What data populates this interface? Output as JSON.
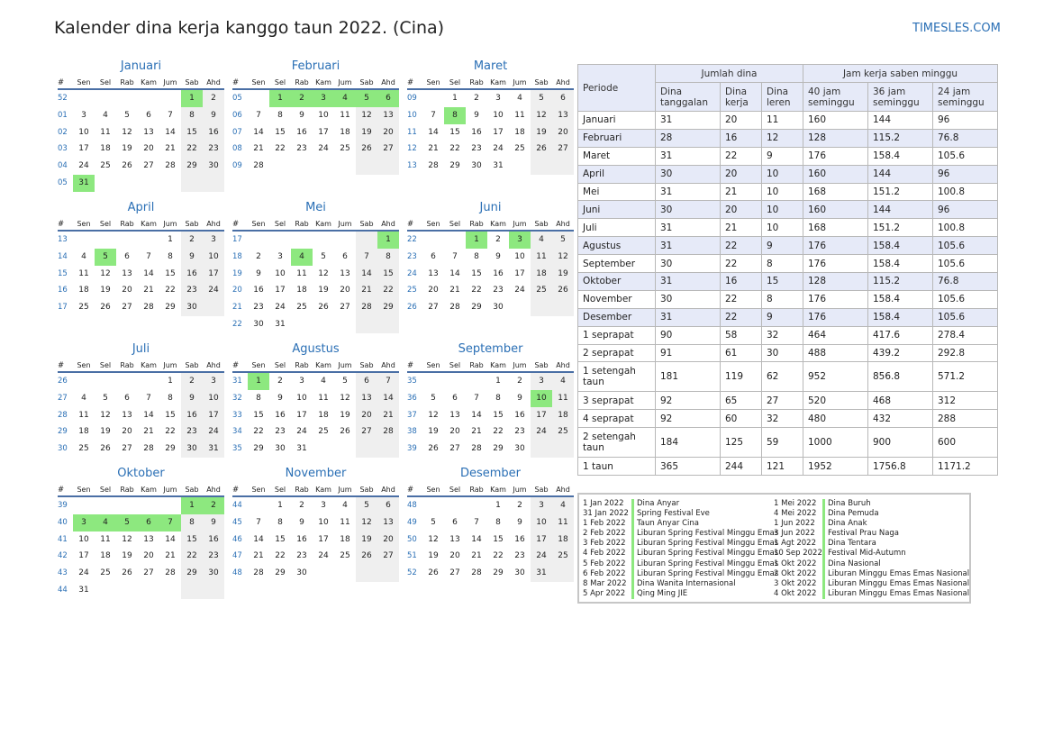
{
  "title": "Kalender dina kerja kanggo taun 2022. (Cina)",
  "brand": "TIMESLES.COM",
  "weekday_headers": [
    "#",
    "Sen",
    "Sel",
    "Rab",
    "Kam",
    "Jum",
    "Sab",
    "Ahd"
  ],
  "months": [
    {
      "name": "Januari",
      "rows": [
        {
          "wk": "52",
          "days": [
            "",
            "",
            "",
            "",
            "",
            "1",
            "2"
          ]
        },
        {
          "wk": "01",
          "days": [
            "3",
            "4",
            "5",
            "6",
            "7",
            "8",
            "9"
          ]
        },
        {
          "wk": "02",
          "days": [
            "10",
            "11",
            "12",
            "13",
            "14",
            "15",
            "16"
          ]
        },
        {
          "wk": "03",
          "days": [
            "17",
            "18",
            "19",
            "20",
            "21",
            "22",
            "23"
          ]
        },
        {
          "wk": "04",
          "days": [
            "24",
            "25",
            "26",
            "27",
            "28",
            "29",
            "30"
          ]
        },
        {
          "wk": "05",
          "days": [
            "31",
            "",
            "",
            "",
            "",
            "",
            ""
          ]
        }
      ],
      "holidays": [
        "1",
        "31"
      ]
    },
    {
      "name": "Februari",
      "rows": [
        {
          "wk": "05",
          "days": [
            "",
            "1",
            "2",
            "3",
            "4",
            "5",
            "6"
          ]
        },
        {
          "wk": "06",
          "days": [
            "7",
            "8",
            "9",
            "10",
            "11",
            "12",
            "13"
          ]
        },
        {
          "wk": "07",
          "days": [
            "14",
            "15",
            "16",
            "17",
            "18",
            "19",
            "20"
          ]
        },
        {
          "wk": "08",
          "days": [
            "21",
            "22",
            "23",
            "24",
            "25",
            "26",
            "27"
          ]
        },
        {
          "wk": "09",
          "days": [
            "28",
            "",
            "",
            "",
            "",
            "",
            ""
          ]
        }
      ],
      "holidays": [
        "1",
        "2",
        "3",
        "4",
        "5",
        "6"
      ]
    },
    {
      "name": "Maret",
      "rows": [
        {
          "wk": "09",
          "days": [
            "",
            "1",
            "2",
            "3",
            "4",
            "5",
            "6"
          ]
        },
        {
          "wk": "10",
          "days": [
            "7",
            "8",
            "9",
            "10",
            "11",
            "12",
            "13"
          ]
        },
        {
          "wk": "11",
          "days": [
            "14",
            "15",
            "16",
            "17",
            "18",
            "19",
            "20"
          ]
        },
        {
          "wk": "12",
          "days": [
            "21",
            "22",
            "23",
            "24",
            "25",
            "26",
            "27"
          ]
        },
        {
          "wk": "13",
          "days": [
            "28",
            "29",
            "30",
            "31",
            "",
            "",
            ""
          ]
        }
      ],
      "holidays": [
        "8"
      ]
    },
    {
      "name": "April",
      "rows": [
        {
          "wk": "13",
          "days": [
            "",
            "",
            "",
            "",
            "1",
            "2",
            "3"
          ]
        },
        {
          "wk": "14",
          "days": [
            "4",
            "5",
            "6",
            "7",
            "8",
            "9",
            "10"
          ]
        },
        {
          "wk": "15",
          "days": [
            "11",
            "12",
            "13",
            "14",
            "15",
            "16",
            "17"
          ]
        },
        {
          "wk": "16",
          "days": [
            "18",
            "19",
            "20",
            "21",
            "22",
            "23",
            "24"
          ]
        },
        {
          "wk": "17",
          "days": [
            "25",
            "26",
            "27",
            "28",
            "29",
            "30",
            ""
          ]
        }
      ],
      "holidays": [
        "5"
      ]
    },
    {
      "name": "Mei",
      "rows": [
        {
          "wk": "17",
          "days": [
            "",
            "",
            "",
            "",
            "",
            "",
            "1"
          ]
        },
        {
          "wk": "18",
          "days": [
            "2",
            "3",
            "4",
            "5",
            "6",
            "7",
            "8"
          ]
        },
        {
          "wk": "19",
          "days": [
            "9",
            "10",
            "11",
            "12",
            "13",
            "14",
            "15"
          ]
        },
        {
          "wk": "20",
          "days": [
            "16",
            "17",
            "18",
            "19",
            "20",
            "21",
            "22"
          ]
        },
        {
          "wk": "21",
          "days": [
            "23",
            "24",
            "25",
            "26",
            "27",
            "28",
            "29"
          ]
        },
        {
          "wk": "22",
          "days": [
            "30",
            "31",
            "",
            "",
            "",
            "",
            ""
          ]
        }
      ],
      "holidays": [
        "1",
        "4"
      ]
    },
    {
      "name": "Juni",
      "rows": [
        {
          "wk": "22",
          "days": [
            "",
            "",
            "1",
            "2",
            "3",
            "4",
            "5"
          ]
        },
        {
          "wk": "23",
          "days": [
            "6",
            "7",
            "8",
            "9",
            "10",
            "11",
            "12"
          ]
        },
        {
          "wk": "24",
          "days": [
            "13",
            "14",
            "15",
            "16",
            "17",
            "18",
            "19"
          ]
        },
        {
          "wk": "25",
          "days": [
            "20",
            "21",
            "22",
            "23",
            "24",
            "25",
            "26"
          ]
        },
        {
          "wk": "26",
          "days": [
            "27",
            "28",
            "29",
            "30",
            "",
            "",
            ""
          ]
        }
      ],
      "holidays": [
        "1",
        "3"
      ]
    },
    {
      "name": "Juli",
      "rows": [
        {
          "wk": "26",
          "days": [
            "",
            "",
            "",
            "",
            "1",
            "2",
            "3"
          ]
        },
        {
          "wk": "27",
          "days": [
            "4",
            "5",
            "6",
            "7",
            "8",
            "9",
            "10"
          ]
        },
        {
          "wk": "28",
          "days": [
            "11",
            "12",
            "13",
            "14",
            "15",
            "16",
            "17"
          ]
        },
        {
          "wk": "29",
          "days": [
            "18",
            "19",
            "20",
            "21",
            "22",
            "23",
            "24"
          ]
        },
        {
          "wk": "30",
          "days": [
            "25",
            "26",
            "27",
            "28",
            "29",
            "30",
            "31"
          ]
        }
      ],
      "holidays": []
    },
    {
      "name": "Agustus",
      "rows": [
        {
          "wk": "31",
          "days": [
            "1",
            "2",
            "3",
            "4",
            "5",
            "6",
            "7"
          ]
        },
        {
          "wk": "32",
          "days": [
            "8",
            "9",
            "10",
            "11",
            "12",
            "13",
            "14"
          ]
        },
        {
          "wk": "33",
          "days": [
            "15",
            "16",
            "17",
            "18",
            "19",
            "20",
            "21"
          ]
        },
        {
          "wk": "34",
          "days": [
            "22",
            "23",
            "24",
            "25",
            "26",
            "27",
            "28"
          ]
        },
        {
          "wk": "35",
          "days": [
            "29",
            "30",
            "31",
            "",
            "",
            "",
            ""
          ]
        }
      ],
      "holidays": [
        "1"
      ]
    },
    {
      "name": "September",
      "rows": [
        {
          "wk": "35",
          "days": [
            "",
            "",
            "",
            "1",
            "2",
            "3",
            "4"
          ]
        },
        {
          "wk": "36",
          "days": [
            "5",
            "6",
            "7",
            "8",
            "9",
            "10",
            "11"
          ]
        },
        {
          "wk": "37",
          "days": [
            "12",
            "13",
            "14",
            "15",
            "16",
            "17",
            "18"
          ]
        },
        {
          "wk": "38",
          "days": [
            "19",
            "20",
            "21",
            "22",
            "23",
            "24",
            "25"
          ]
        },
        {
          "wk": "39",
          "days": [
            "26",
            "27",
            "28",
            "29",
            "30",
            "",
            ""
          ]
        }
      ],
      "holidays": [
        "10"
      ]
    },
    {
      "name": "Oktober",
      "rows": [
        {
          "wk": "39",
          "days": [
            "",
            "",
            "",
            "",
            "",
            "1",
            "2"
          ]
        },
        {
          "wk": "40",
          "days": [
            "3",
            "4",
            "5",
            "6",
            "7",
            "8",
            "9"
          ]
        },
        {
          "wk": "41",
          "days": [
            "10",
            "11",
            "12",
            "13",
            "14",
            "15",
            "16"
          ]
        },
        {
          "wk": "42",
          "days": [
            "17",
            "18",
            "19",
            "20",
            "21",
            "22",
            "23"
          ]
        },
        {
          "wk": "43",
          "days": [
            "24",
            "25",
            "26",
            "27",
            "28",
            "29",
            "30"
          ]
        },
        {
          "wk": "44",
          "days": [
            "31",
            "",
            "",
            "",
            "",
            "",
            ""
          ]
        }
      ],
      "holidays": [
        "1",
        "2",
        "3",
        "4",
        "5",
        "6",
        "7"
      ]
    },
    {
      "name": "November",
      "rows": [
        {
          "wk": "44",
          "days": [
            "",
            "1",
            "2",
            "3",
            "4",
            "5",
            "6"
          ]
        },
        {
          "wk": "45",
          "days": [
            "7",
            "8",
            "9",
            "10",
            "11",
            "12",
            "13"
          ]
        },
        {
          "wk": "46",
          "days": [
            "14",
            "15",
            "16",
            "17",
            "18",
            "19",
            "20"
          ]
        },
        {
          "wk": "47",
          "days": [
            "21",
            "22",
            "23",
            "24",
            "25",
            "26",
            "27"
          ]
        },
        {
          "wk": "48",
          "days": [
            "28",
            "29",
            "30",
            "",
            "",
            "",
            ""
          ]
        }
      ],
      "holidays": []
    },
    {
      "name": "Desember",
      "rows": [
        {
          "wk": "48",
          "days": [
            "",
            "",
            "",
            "1",
            "2",
            "3",
            "4"
          ]
        },
        {
          "wk": "49",
          "days": [
            "5",
            "6",
            "7",
            "8",
            "9",
            "10",
            "11"
          ]
        },
        {
          "wk": "50",
          "days": [
            "12",
            "13",
            "14",
            "15",
            "16",
            "17",
            "18"
          ]
        },
        {
          "wk": "51",
          "days": [
            "19",
            "20",
            "21",
            "22",
            "23",
            "24",
            "25"
          ]
        },
        {
          "wk": "52",
          "days": [
            "26",
            "27",
            "28",
            "29",
            "30",
            "31",
            ""
          ]
        }
      ],
      "holidays": []
    }
  ],
  "table": {
    "periode": "Periode",
    "jumlah_dina": "Jumlah dina",
    "jam_kerja": "Jam kerja saben minggu",
    "subheaders": [
      "Dina tanggalan",
      "Dina kerja",
      "Dina leren",
      "40 jam seminggu",
      "36 jam seminggu",
      "24 jam seminggu"
    ],
    "rows": [
      [
        "Januari",
        "31",
        "20",
        "11",
        "160",
        "144",
        "96"
      ],
      [
        "Februari",
        "28",
        "16",
        "12",
        "128",
        "115.2",
        "76.8"
      ],
      [
        "Maret",
        "31",
        "22",
        "9",
        "176",
        "158.4",
        "105.6"
      ],
      [
        "April",
        "30",
        "20",
        "10",
        "160",
        "144",
        "96"
      ],
      [
        "Mei",
        "31",
        "21",
        "10",
        "168",
        "151.2",
        "100.8"
      ],
      [
        "Juni",
        "30",
        "20",
        "10",
        "160",
        "144",
        "96"
      ],
      [
        "Juli",
        "31",
        "21",
        "10",
        "168",
        "151.2",
        "100.8"
      ],
      [
        "Agustus",
        "31",
        "22",
        "9",
        "176",
        "158.4",
        "105.6"
      ],
      [
        "September",
        "30",
        "22",
        "8",
        "176",
        "158.4",
        "105.6"
      ],
      [
        "Oktober",
        "31",
        "16",
        "15",
        "128",
        "115.2",
        "76.8"
      ],
      [
        "November",
        "30",
        "22",
        "8",
        "176",
        "158.4",
        "105.6"
      ],
      [
        "Desember",
        "31",
        "22",
        "9",
        "176",
        "158.4",
        "105.6"
      ],
      [
        "1 seprapat",
        "90",
        "58",
        "32",
        "464",
        "417.6",
        "278.4"
      ],
      [
        "2 seprapat",
        "91",
        "61",
        "30",
        "488",
        "439.2",
        "292.8"
      ],
      [
        "1 setengah taun",
        "181",
        "119",
        "62",
        "952",
        "856.8",
        "571.2"
      ],
      [
        "3 seprapat",
        "92",
        "65",
        "27",
        "520",
        "468",
        "312"
      ],
      [
        "4 seprapat",
        "92",
        "60",
        "32",
        "480",
        "432",
        "288"
      ],
      [
        "2 setengah taun",
        "184",
        "125",
        "59",
        "1000",
        "900",
        "600"
      ],
      [
        "1 taun",
        "365",
        "244",
        "121",
        "1952",
        "1756.8",
        "1171.2"
      ]
    ]
  },
  "holidays_left": [
    {
      "date": "1 Jan 2022",
      "name": "Dina Anyar"
    },
    {
      "date": "31 Jan 2022",
      "name": "Spring Festival Eve"
    },
    {
      "date": "1 Feb 2022",
      "name": "Taun Anyar Cina"
    },
    {
      "date": "2 Feb 2022",
      "name": "Liburan Spring Festival Minggu Emas"
    },
    {
      "date": "3 Feb 2022",
      "name": "Liburan Spring Festival Minggu Emas"
    },
    {
      "date": "4 Feb 2022",
      "name": "Liburan Spring Festival Minggu Emas"
    },
    {
      "date": "5 Feb 2022",
      "name": "Liburan Spring Festival Minggu Emas"
    },
    {
      "date": "6 Feb 2022",
      "name": "Liburan Spring Festival Minggu Emas"
    },
    {
      "date": "8 Mar 2022",
      "name": "Dina Wanita Internasional"
    },
    {
      "date": "5 Apr 2022",
      "name": "Qing Ming JIE"
    }
  ],
  "holidays_right": [
    {
      "date": "1 Mei 2022",
      "name": "Dina Buruh"
    },
    {
      "date": "4 Mei 2022",
      "name": "Dina Pemuda"
    },
    {
      "date": "1 Jun 2022",
      "name": "Dina Anak"
    },
    {
      "date": "3 Jun 2022",
      "name": "Festival Prau Naga"
    },
    {
      "date": "1 Agt 2022",
      "name": "Dina Tentara"
    },
    {
      "date": "10 Sep 2022",
      "name": "Festival Mid-Autumn"
    },
    {
      "date": "1 Okt 2022",
      "name": "Dina Nasional"
    },
    {
      "date": "2 Okt 2022",
      "name": "Liburan Minggu Emas Emas Nasional"
    },
    {
      "date": "3 Okt 2022",
      "name": "Liburan Minggu Emas Emas Nasional"
    },
    {
      "date": "4 Okt 2022",
      "name": "Liburan Minggu Emas Emas Nasional"
    }
  ]
}
